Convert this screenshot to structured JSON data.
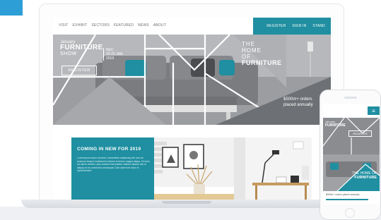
{
  "nav": {
    "left": [
      "VISIT",
      "EXHIBIT",
      "SECTORS",
      "FEATURED",
      "NEWS",
      "ABOUT"
    ],
    "right": [
      "REGISTER",
      "SIGN IN",
      "STAND"
    ]
  },
  "hero": {
    "brand_line1": "January",
    "brand_line2": "FURNITURE",
    "brand_line3": "SHOW",
    "date_line1": "NEC",
    "date_line2": "20-23 JAN",
    "date_line3": "2019",
    "register_label": "REGISTER",
    "home_line1": "THE",
    "home_line2": "HOME",
    "home_line3": "OF",
    "home_line4": "FURNITURE",
    "caption_line1": "$500m+ orders",
    "caption_line2": "placed annually"
  },
  "coming": {
    "title": "COMING IN NEW FOR 2019",
    "body": "Lorem ipsum dolor sit amet, consectetur adipiscing elit, sed do eiusmod tempor incididunt ut labore et dolore magna aliqua. Ut enim ad minim veniam, quis nostrud exercitation ullamco laboris nisi ut aliquip ex ea commodo consequat. Duis aute irure dolor in reprehenderit."
  },
  "phone": {
    "menu_icon": "hamburger-icon",
    "brand_line1": "January",
    "brand_line2": "FURNITURE",
    "register_label": "REGISTER",
    "home_line1": "THE HOME OF",
    "home_line2": "FURNITURE",
    "caption": "$500m+ orders placed annually"
  },
  "colors": {
    "accent": "#1f8fa1",
    "corner_chip": "#2e9fd6",
    "hero_grey": "#8d8f93"
  }
}
